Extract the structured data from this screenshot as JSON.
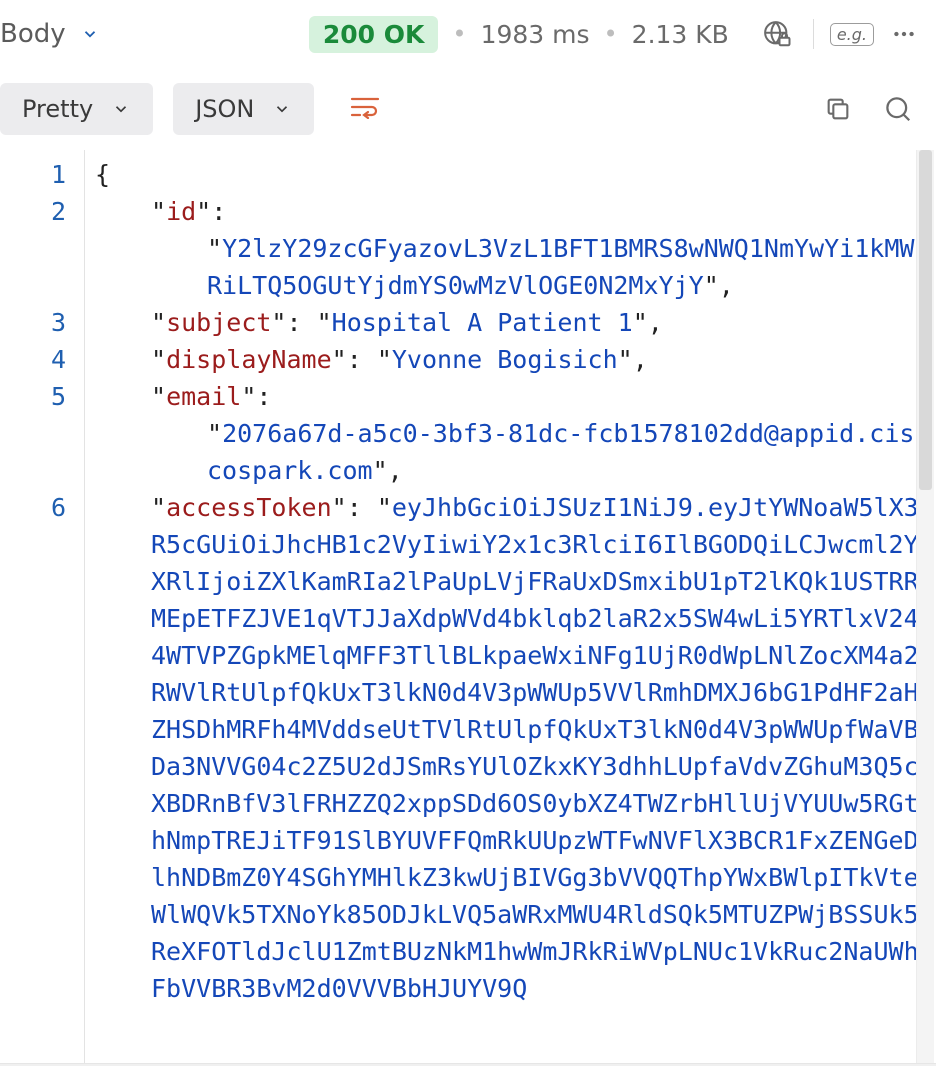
{
  "header": {
    "tab_label": "Body",
    "status_text": "200 OK",
    "time_text": "1983 ms",
    "size_text": "2.13 KB",
    "example_box": "e.g."
  },
  "toolbar": {
    "pretty_label": "Pretty",
    "format_label": "JSON"
  },
  "gutter": {
    "lines": [
      "1",
      "2",
      "",
      "3",
      "4",
      "5",
      "",
      "6"
    ]
  },
  "json_body": {
    "keys": {
      "id": "id",
      "subject": "subject",
      "displayName": "displayName",
      "email": "email",
      "accessToken": "accessToken"
    },
    "values": {
      "id": "Y2lzY29zcGFyazovL3VzL1BFT1BMRS8wNWQ1NmYwYi1kMWRiLTQ5OGUtYjdmYS0wMzVlOGE0N2MxYjY",
      "subject": "Hospital A Patient 1",
      "displayName": "Yvonne Bogisich",
      "email": "2076a67d-a5c0-3bf3-81dc-fcb1578102dd@appid.ciscospark.com",
      "accessToken": "eyJhbGciOiJSUzI1NiJ9.eyJtYWNoaW5lX3R5cGUiOiJhcHB1c2VyIiwiY2x1c3RlciI6IlBGODQiLCJwcml2YXRlIjoiZXlKamRIa2lPaUpLVjFRaUxDSmxibU1pT2lKQk1USTRRMEpETFZJVE1qVTJJaXdpWVd4bklqb2laR2x5SW4wLi5YRTlxV244WTVPZGpkMElqMFF3TllBLkpaeWxiNFg1UjR0dWpLNlZocXM4a2RWVlRtUlpfQkUxT3lkN0d4V3pWWUp5VVlRmhDMXJ6bG1PdHF2aHZHSDhMRFh4MVddseUtTVlRtUlpfQkUxT3lkN0d4V3pWWUpfWaVBDa3NVVG04c2Z5U2dJSmRsYUlOZkxKY3dhhLUpfaVdvZGhuM3Q5cXBDRnBfV3lFRHZZQ2xppSDd6OS0ybXZ4TWZrbHllUjVYUUw5RGthNmpTREJiTF91SlBYUVFFQmRkUUpzWTFwNVFlX3BCR1FxZENGeDlhNDBmZ0Y4SGhYMHlkZ3kwUjBIVGg3bVVQQThpYWxBWlpITkVteWlWQVk5TXNoYk85ODJkLVQ5aWRxMWU4RldSQk5MTUZPWjBSSUk5ReXFOTldJclU1ZmtBUzNkM1hwWmJRkRiWVpLNUc1VkRuc2NaUWhFbVVBR3BvM2d0VVVBbHJUYV9Q"
    }
  }
}
